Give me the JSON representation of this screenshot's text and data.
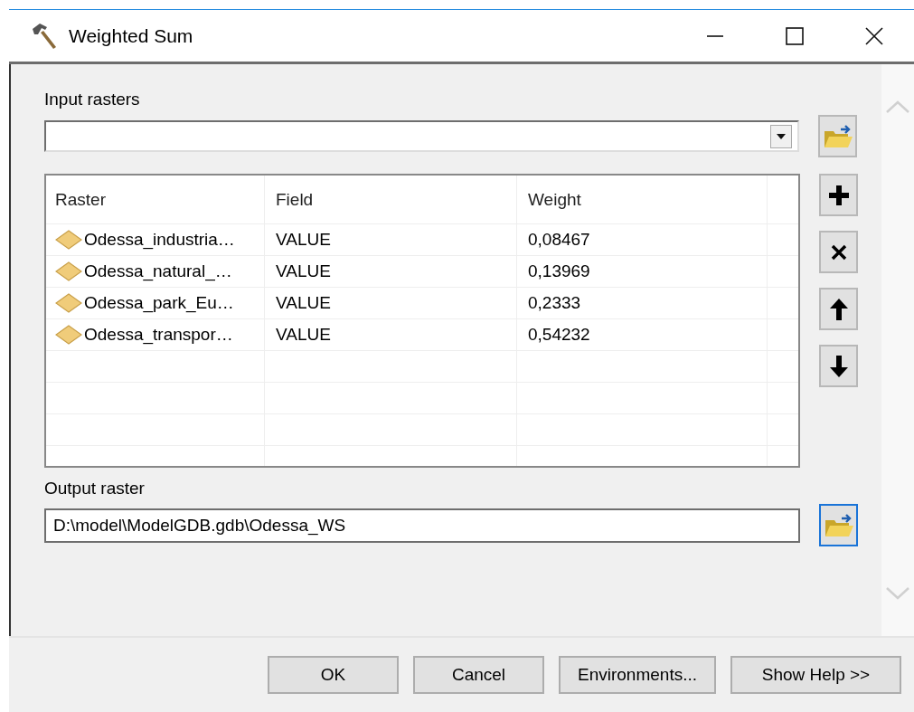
{
  "window": {
    "title": "Weighted Sum"
  },
  "input_rasters": {
    "label": "Input rasters",
    "browse_focused": false
  },
  "table": {
    "columns": [
      "Raster",
      "Field",
      "Weight"
    ],
    "rows": [
      {
        "raster": "Odessa_industria…",
        "field": "VALUE",
        "weight": "0,08467"
      },
      {
        "raster": "Odessa_natural_…",
        "field": "VALUE",
        "weight": "0,13969"
      },
      {
        "raster": "Odessa_park_Eu…",
        "field": "VALUE",
        "weight": "0,2333"
      },
      {
        "raster": "Odessa_transpor…",
        "field": "VALUE",
        "weight": "0,54232"
      }
    ]
  },
  "side_buttons": [
    {
      "kind": "add"
    },
    {
      "kind": "remove"
    },
    {
      "kind": "up"
    },
    {
      "kind": "down"
    }
  ],
  "output_raster": {
    "label": "Output raster",
    "value": "D:\\model\\ModelGDB.gdb\\Odessa_WS",
    "browse_focused": true
  },
  "buttons": [
    "OK",
    "Cancel",
    "Environments...",
    "Show Help >>"
  ]
}
